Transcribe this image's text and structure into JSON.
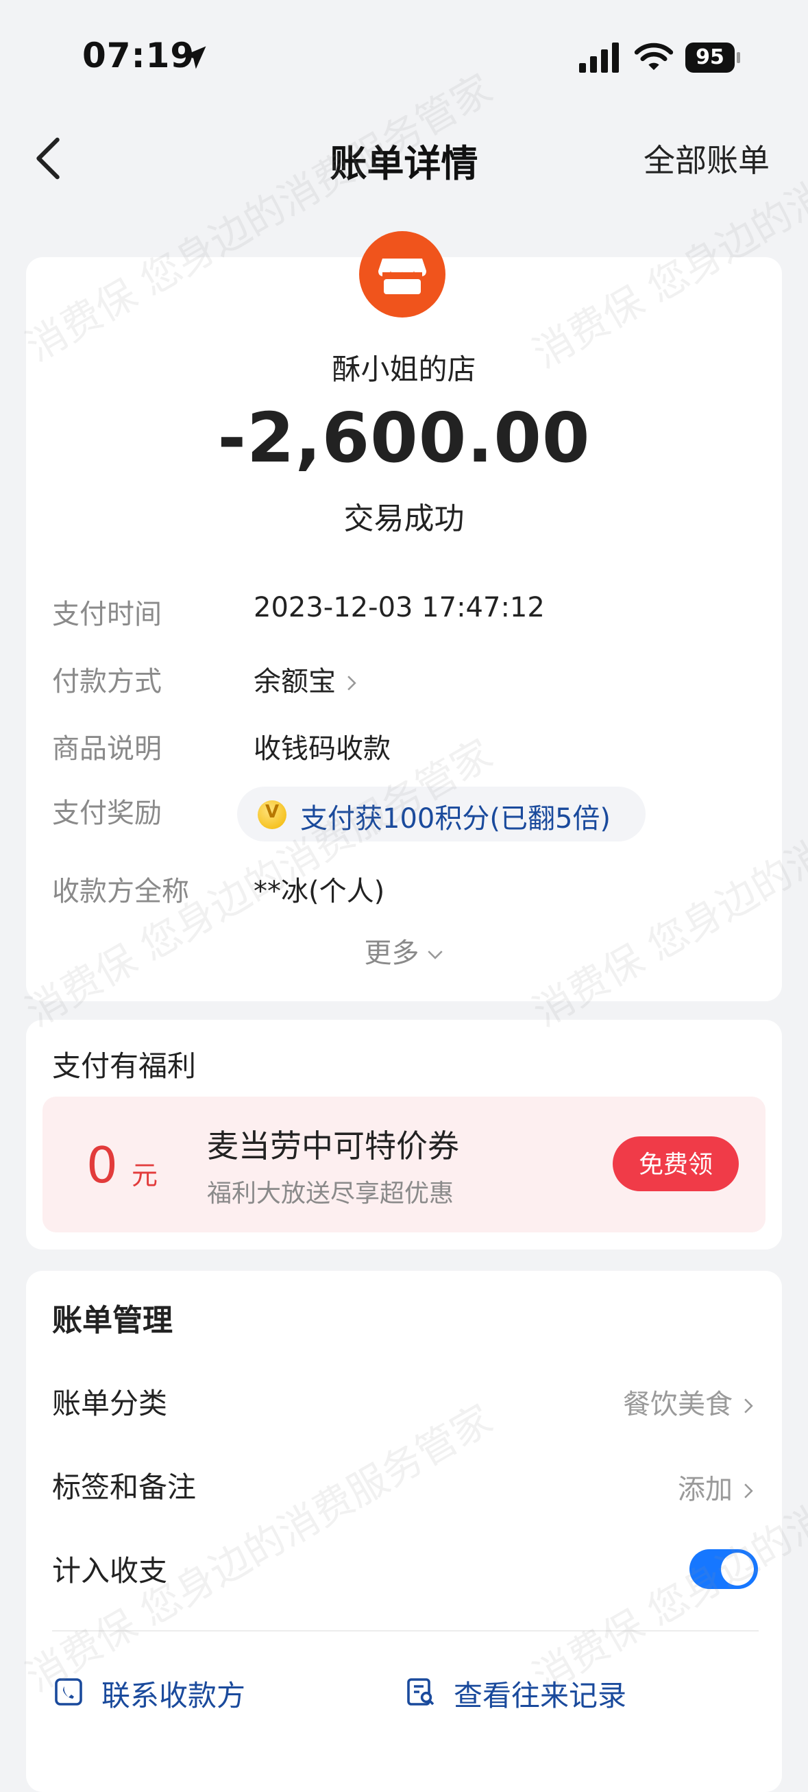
{
  "status_bar": {
    "time": "07:19",
    "battery": "95"
  },
  "nav": {
    "title": "账单详情",
    "right_link": "全部账单"
  },
  "detail": {
    "shop_name": "酥小姐的店",
    "amount": "-2,600.00",
    "status": "交易成功",
    "rows": {
      "pay_time": {
        "label": "支付时间",
        "value": "2023-12-03 17:47:12"
      },
      "pay_method": {
        "label": "付款方式",
        "value": "余额宝"
      },
      "goods_desc": {
        "label": "商品说明",
        "value": "收钱码收款"
      },
      "reward": {
        "label": "支付奖励",
        "value": "支付获100积分(已翻5倍)",
        "coin_glyph": "V"
      },
      "payee": {
        "label": "收款方全称",
        "value": "**冰(个人)"
      }
    },
    "more_label": "更多"
  },
  "benefit": {
    "title": "支付有福利",
    "coupon": {
      "amount": "0",
      "unit": "元",
      "title": "麦当劳中可特价券",
      "subtitle": "福利大放送尽享超优惠",
      "button": "免费领"
    }
  },
  "manage": {
    "title": "账单管理",
    "category": {
      "label": "账单分类",
      "value": "餐饮美食"
    },
    "tags": {
      "label": "标签和备注",
      "value": "添加"
    },
    "include": {
      "label": "计入收支",
      "on": true
    },
    "actions": {
      "contact": "联系收款方",
      "history": "查看往来记录"
    }
  },
  "watermark_text": "消费保 您身边的消费服务管家",
  "colors": {
    "accent_blue": "#1677ff",
    "shop_orange": "#f0541c",
    "coupon_red": "#f03b48",
    "link_blue": "#1a4a9c"
  }
}
